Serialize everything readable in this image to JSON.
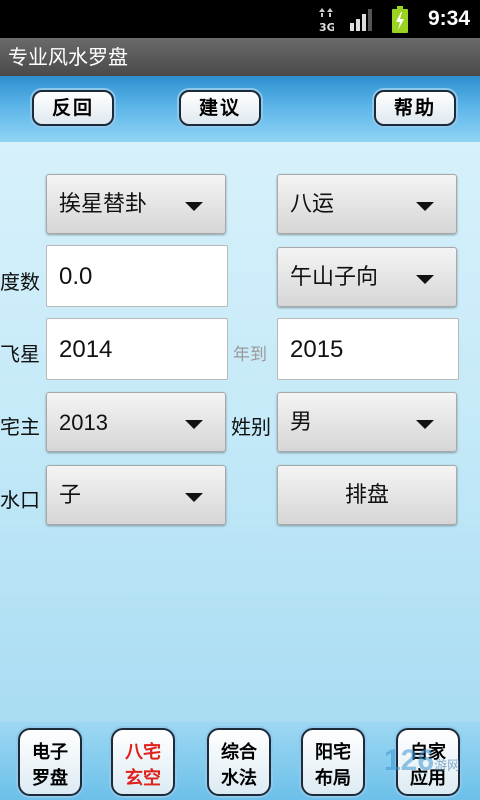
{
  "status_bar": {
    "time": "9:34",
    "network": "3G"
  },
  "app": {
    "title": "专业风水罗盘"
  },
  "toolbar": {
    "back": "反回",
    "suggest": "建议",
    "help": "帮助"
  },
  "form": {
    "method": "挨星替卦",
    "period": "八运",
    "degree_label": "度数",
    "degree_value": "0.0",
    "direction": "午山子向",
    "flying_star_label": "飞星",
    "year_from": "2014",
    "year_to_label": "年到",
    "year_to": "2015",
    "owner_label": "宅主",
    "owner_year": "2013",
    "gender_label": "姓别",
    "gender": "男",
    "water_label": "水口",
    "water": "子",
    "arrange_button": "排盘"
  },
  "bottom_nav": {
    "items": [
      {
        "line1": "电子",
        "line2": "罗盘"
      },
      {
        "line1": "八宅",
        "line2": "玄空"
      },
      {
        "line1": "综合",
        "line2": "水法"
      },
      {
        "line1": "阳宅",
        "line2": "布局"
      },
      {
        "line1": "自家",
        "line2": "应用"
      }
    ],
    "active_index": 1,
    "active_color": "#e0201a"
  },
  "watermark": {
    "text": "126",
    "sub": "游网"
  }
}
